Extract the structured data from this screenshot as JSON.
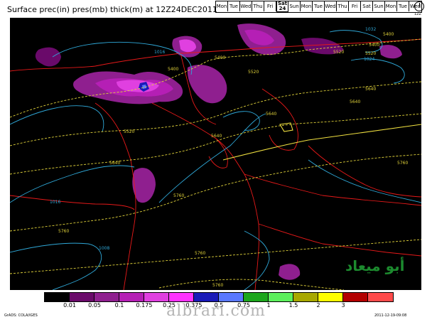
{
  "title": "Surface prec(in) pres(mb) thick(m) at 12Z24DEC2011",
  "day_strip": {
    "days": [
      "Mon",
      "Tue",
      "Wed",
      "Thu",
      "Fri",
      "Sat",
      "Sun",
      "Mon",
      "Tue",
      "Wed",
      "Thu",
      "Fri",
      "Sat",
      "Sun",
      "Mon",
      "Tue",
      "Wed"
    ],
    "current_index": 5,
    "current_date": "24"
  },
  "dial_label": "12Z",
  "map": {
    "thickness_labels": [
      "5400",
      "5400",
      "5520",
      "5400",
      "5520",
      "5640",
      "5640",
      "5520",
      "5640",
      "5640",
      "5760",
      "5760",
      "5760",
      "5760",
      "5760",
      "5640",
      "5520",
      "5400"
    ],
    "pressure_labels": [
      "1016",
      "1016",
      "1008",
      "1032",
      "1024"
    ]
  },
  "arabic_brand": "أبو ميعاد",
  "legend": {
    "colors": [
      "#000000",
      "#6a0a6a",
      "#8f1f8f",
      "#b51fb5",
      "#e040e0",
      "#ff33ff",
      "#1a1ab8",
      "#5a78ff",
      "#1ca61c",
      "#5cf05c",
      "#a8a800",
      "#ffff00",
      "#b30000",
      "#ff4a4a"
    ],
    "labels": [
      "0.01",
      "0.05",
      "0.1",
      "0.175",
      "0.25",
      "0.375",
      "0.5",
      "0.75",
      "1",
      "1.5",
      "2",
      "3"
    ]
  },
  "footer_left": "GrADS: COLA/IGES",
  "footer_right": "2011-12-19-09:08",
  "watermark": "albrari.com"
}
